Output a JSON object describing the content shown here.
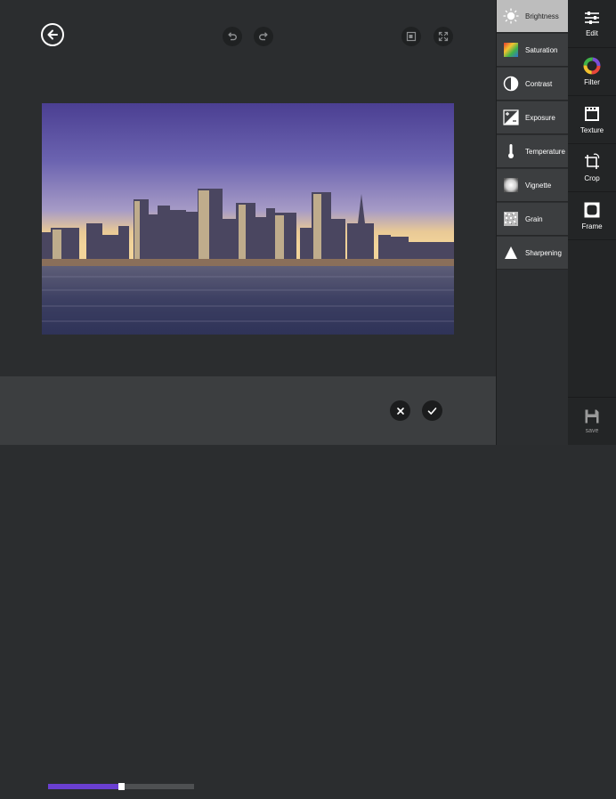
{
  "editor": {
    "icons": {
      "back": "back-arrow-icon",
      "undo": "undo-icon",
      "redo": "redo-icon",
      "compare": "compare-icon",
      "fullscreen": "fullscreen-icon",
      "cancel": "close-icon",
      "apply": "check-icon"
    },
    "slider": {
      "value": 0.5,
      "fill_color": "#6a3fd1"
    },
    "photo_description_icon": "skyline-photo"
  },
  "adjustments": [
    {
      "label": "Brightness",
      "icon": "sun-icon",
      "active": true
    },
    {
      "label": "Saturation",
      "icon": "saturation-icon",
      "active": false
    },
    {
      "label": "Contrast",
      "icon": "contrast-icon",
      "active": false
    },
    {
      "label": "Exposure",
      "icon": "exposure-icon",
      "active": false
    },
    {
      "label": "Temperature",
      "icon": "thermometer-icon",
      "active": false
    },
    {
      "label": "Vignette",
      "icon": "vignette-icon",
      "active": false
    },
    {
      "label": "Grain",
      "icon": "grain-icon",
      "active": false
    },
    {
      "label": "Sharpening",
      "icon": "sharpening-icon",
      "active": false
    }
  ],
  "tools": [
    {
      "label": "Edit",
      "icon": "sliders-icon"
    },
    {
      "label": "Filter",
      "icon": "filter-icon"
    },
    {
      "label": "Texture",
      "icon": "texture-icon"
    },
    {
      "label": "Crop",
      "icon": "crop-icon"
    },
    {
      "label": "Frame",
      "icon": "frame-icon"
    }
  ],
  "save": {
    "label": "save",
    "icon": "save-icon"
  },
  "colors": {
    "accent": "#6a3fd1",
    "active_item": "#bdbdbd"
  }
}
